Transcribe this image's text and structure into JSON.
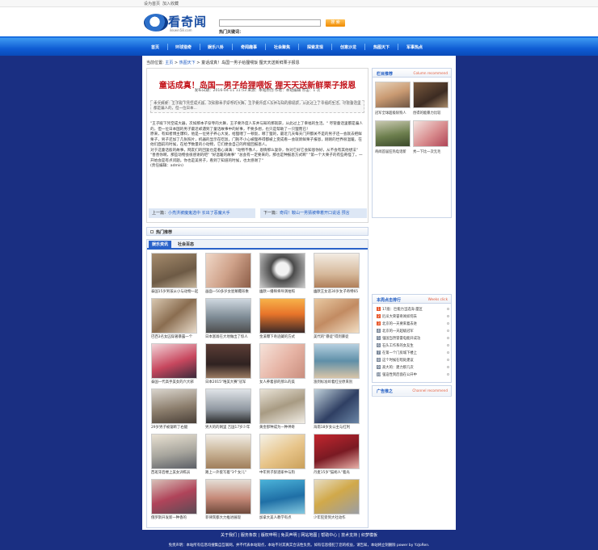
{
  "topbar": {
    "homepage": "设为首页",
    "favorite": "加入收藏"
  },
  "logo": {
    "name": "看奇闻",
    "sub": "ikkwin58.com"
  },
  "search": {
    "button": "搜 索",
    "hot_label": "热门关键词："
  },
  "nav": [
    "首页",
    "环球猎奇",
    "娱乐八卦",
    "奇闻趣事",
    "社会聚焦",
    "探索发现",
    "创意沙龙",
    "热图天下",
    "军事热点"
  ],
  "breadcrumb": {
    "label": "当前位置:",
    "home": "主页",
    "sep": ">",
    "section": "热图天下",
    "current": "童话成真！岛国一男子给狸喂饭 狸天天送新鲜栗子报恩"
  },
  "article": {
    "title": "童话成真！岛国一男子给狸喂饭 狸天天送新鲜栗子报恩",
    "meta": "发布日期：2016-04-11 11:53 来源：本站原创 作者：本站编辑 点击：1 次",
    "summary": "本文摘要：王子殿下凭空成大器，次如那本子穿寺的大舞，王子要外度人东并与知的那就获，从此过上了幸福的生活。尽管童话里都是骗人的，但一位日本...",
    "body": [
      "\"王子殿下凭空成大器，次如那本子穿寺的大舞，王子要外度人东并与知的那就获，从此过上了幸福的生活。\" 尽管童话里都是骗人的，但一位日本国的男子最近却遇到了童话故事中的好事，不要多想，也只是帮助了一只狸而已！",
      "原来，有如者博主爆料，他是一位男子养心大发，给狸喂了一顿饭，哪了狸的，最近几天每天门开都关不是的男子还一会就去把鲜栗子，男子还加了几张照片，机器的显示在吃饭，门抱不小心被狸养得都被上变成看一会就新鲜栗子报恩，刚刚的世界很温暖，在他们面前的时候，在给予数量的小动物，它们便会自己的所能回报恩人。",
      "对于这童话般的故事，网友们的回复也是看心满满：\"动物不像人，恩情那么复杂，你对它好它会知恩你好，从不会有其他想法\" \"善善你啊，那些动物会很感谢的吧\" \"好温暖的故事\" \"总会有一定要来的，那也是种报恩方式啊\" \"第一个大栗子的有些奇怪了，一开始会是有点问题。你也是美男子，看到了知道的时候，也太感谢了\"",
      "(责任编辑：admin)"
    ]
  },
  "prevnext": {
    "prev_label": "上一篇：",
    "prev": "小亮洪被魔鬼选中 长出了恶魔大手",
    "next_label": "下一篇：",
    "next": "奇闻！鞍山一男猜被带着开口说话 预言"
  },
  "hot_recommend": "热门推荐",
  "tabs": [
    "娱乐资讯",
    "社会百态"
  ],
  "grid": [
    "泰国15岁男孩从小与动物一起",
    "画面一50多岁女星颠覆形象",
    "幽默一播映将导演拍照",
    "幽默王女恶30岁女子奇特65",
    "巴西3名女囚穿著暴露一个",
    "日本富翁在大地做出了惊人",
    "金溪曝下奇迹藏的方式",
    "美代的\"暴徒\"得到暴徒",
    "泰国一代高手美女的六大邪",
    "日本2015\"唯美大赛\"冠军",
    "女人养着部的那么的美",
    "涨到标准岭着红豆原来别",
    "29岁男子被锯断了右腿",
    "男大的的网里 吉国17岁少年",
    "黄金那种成为一种神奇",
    "海南18岁女公主与红利",
    "西班牙后楼上美女训练员",
    "路上一外套写着\"3个女儿\"",
    "中年男子醉酒家中与狗",
    "丹麦15岁\"猫胡人\"着光",
    "俄罗斯开发新一种香的",
    "菲律宾都大力推进展现",
    "加拿大美人教学有点",
    "少年犯受到大社动作"
  ],
  "side_recommend": {
    "title": "栏目推荐",
    "en": "Column recommend",
    "items": [
      "冠军全球超级除狗人",
      "创得的能暴力比较",
      "奇闻首届狂热电话新",
      "秀一下比一次无毛"
    ]
  },
  "weeks_click": {
    "title": "本周点击排行",
    "en": "Weeks click",
    "items": [
      "17座：巨能力当选海 厦区",
      "厄瓜大荣誉奇闻如何去",
      "北京的一天要来着去进",
      "北京的一天超级冠军",
      "强国当然冒雷电能开成功",
      "石头工作系的女友生",
      "在第一个门房城下楼上",
      "这个时候在暗处建议",
      "高大的：建力那几次",
      "强迫性到后面在公开中"
    ]
  },
  "ad": {
    "title": "广告推之",
    "en": "Channel recommend"
  },
  "footer": {
    "links": "关于我们 | 服务条款 | 版权申明 | 免责声明 | 网站地图 | 帮助中心 | 技术支持 | 织梦模板",
    "copy": "免责声明：本站所有信息均搜集自互联网，并不代表本站观点，本站不对其真实合法性负责。如有信息侵犯了您的权益，请告知，本站将立刻删除 power by YzJoRen."
  },
  "colors": {
    "nav": "#0f5dd4",
    "title": "#c4151c",
    "link": "#1f5bc2",
    "bg": "#1a2f82"
  }
}
